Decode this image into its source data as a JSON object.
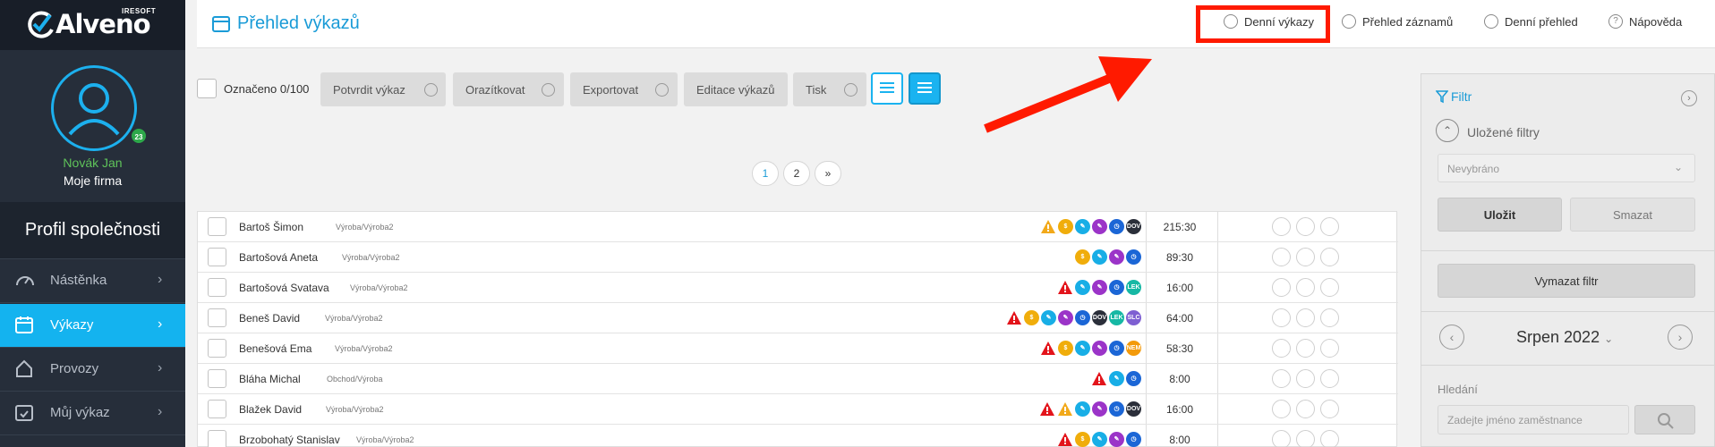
{
  "brand": {
    "name": "Alveno",
    "vendor": "IRESOFT"
  },
  "user": {
    "name": "Novák Jan",
    "firm": "Moje firma",
    "badge": "23"
  },
  "company_title": "Profil společnosti",
  "nav": [
    {
      "label": "Nástěnka",
      "icon": "dashboard-icon"
    },
    {
      "label": "Výkazy",
      "icon": "calendar-icon",
      "active": true
    },
    {
      "label": "Provozy",
      "icon": "home-icon"
    },
    {
      "label": "Můj výkaz",
      "icon": "calendar-check-icon"
    }
  ],
  "page_title": "Přehled výkazů",
  "top_links": [
    "Denní výkazy",
    "Přehled záznamů",
    "Denní přehled",
    "Nápověda"
  ],
  "toolbar": {
    "marked": "Označeno 0/100",
    "buttons": [
      "Potvrdit výkaz",
      "Orazítkovat",
      "Exportovat",
      "Editace výkazů",
      "Tisk"
    ]
  },
  "pagination": [
    "1",
    "2",
    "»"
  ],
  "rows": [
    {
      "name": "Bartoš Šimon",
      "dept": "Výroba/Výroba2",
      "icons": [
        "warn-orange",
        "dollar",
        "pen-cyan",
        "pen-purple",
        "clock",
        "DOV"
      ],
      "time": "215:30"
    },
    {
      "name": "Bartošová Aneta",
      "dept": "Výroba/Výroba2",
      "icons": [
        "dollar",
        "pen-cyan",
        "pen-purple",
        "clock"
      ],
      "time": "89:30"
    },
    {
      "name": "Bartošová Svatava",
      "dept": "Výroba/Výroba2",
      "icons": [
        "warn-red",
        "pen-cyan",
        "pen-purple",
        "clock",
        "LEK"
      ],
      "time": "16:00"
    },
    {
      "name": "Beneš David",
      "dept": "Výroba/Výroba2",
      "icons": [
        "warn-red",
        "dollar",
        "pen-cyan",
        "pen-purple",
        "clock",
        "DOV",
        "LEK",
        "SLC"
      ],
      "time": "64:00"
    },
    {
      "name": "Benešová Ema",
      "dept": "Výroba/Výroba2",
      "icons": [
        "warn-red",
        "dollar",
        "pen-cyan",
        "pen-purple",
        "clock",
        "NEM"
      ],
      "time": "58:30"
    },
    {
      "name": "Bláha Michal",
      "dept": "Obchod/Výroba",
      "icons": [
        "warn-red",
        "pen-cyan",
        "clock"
      ],
      "time": "8:00"
    },
    {
      "name": "Blažek David",
      "dept": "Výroba/Výroba2",
      "icons": [
        "warn-red",
        "warn-orange",
        "pen-cyan",
        "pen-purple",
        "clock",
        "DOV"
      ],
      "time": "16:00"
    },
    {
      "name": "Brzobohatý Stanislav",
      "dept": "Výroba/Výroba2",
      "icons": [
        "warn-red",
        "dollar",
        "pen-cyan",
        "pen-purple",
        "clock"
      ],
      "time": "8:00"
    }
  ],
  "filter": {
    "title": "Filtr",
    "saved_filters": "Uložené filtry",
    "select_value": "Nevybráno",
    "save": "Uložit",
    "delete": "Smazat",
    "clear": "Vymazat filtr",
    "month": "Srpen 2022",
    "search_label": "Hledání",
    "search_placeholder": "Zadejte jméno zaměstnance"
  },
  "colors": {
    "accent": "#14b3ef",
    "sidebar": "#262e3a",
    "highlight": "#ff1a00",
    "green": "#5fc35a"
  }
}
